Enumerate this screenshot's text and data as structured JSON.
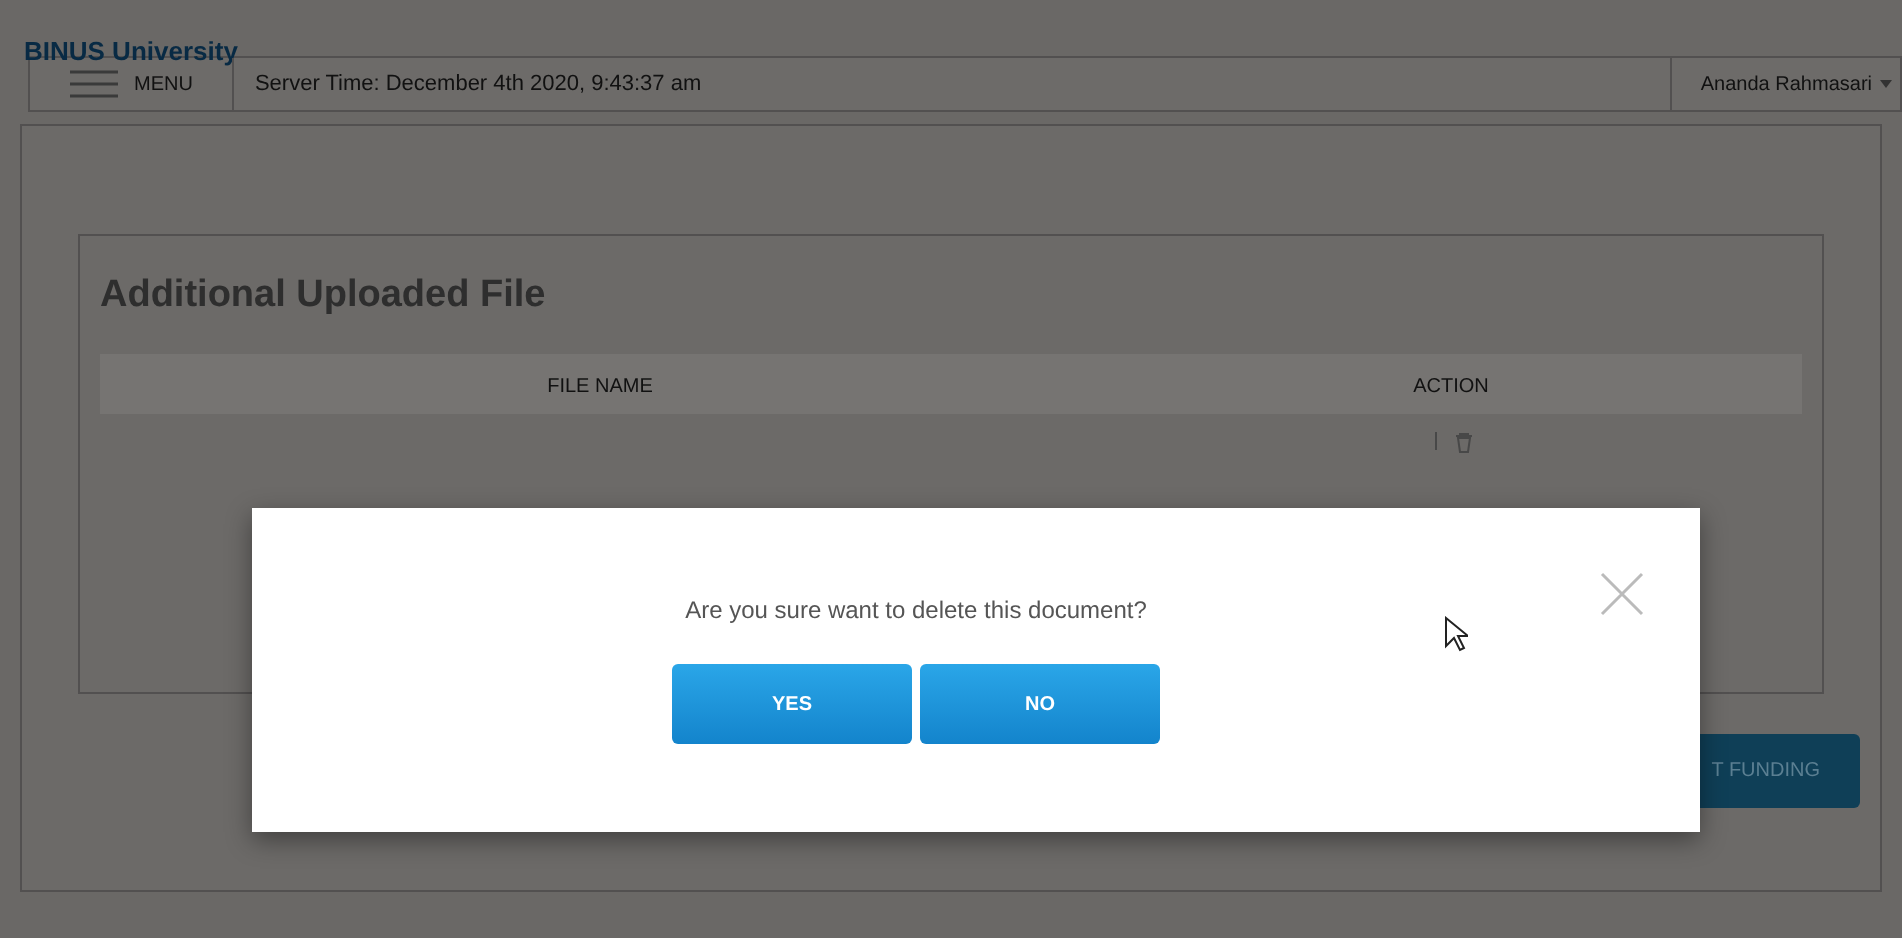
{
  "header": {
    "brand": "BINUS University"
  },
  "topbar": {
    "menu_label": "MENU",
    "server_time": "Server Time: December 4th 2020, 9:43:37 am",
    "user": "Ananda Rahmasari"
  },
  "section": {
    "title": "Additional Uploaded File",
    "table": {
      "columns": [
        "FILE NAME",
        "ACTION"
      ]
    }
  },
  "submit_button": {
    "label": "T FUNDING"
  },
  "dialog": {
    "message": "Are you sure want to delete this document?",
    "buttons": [
      "YES",
      "NO"
    ]
  }
}
